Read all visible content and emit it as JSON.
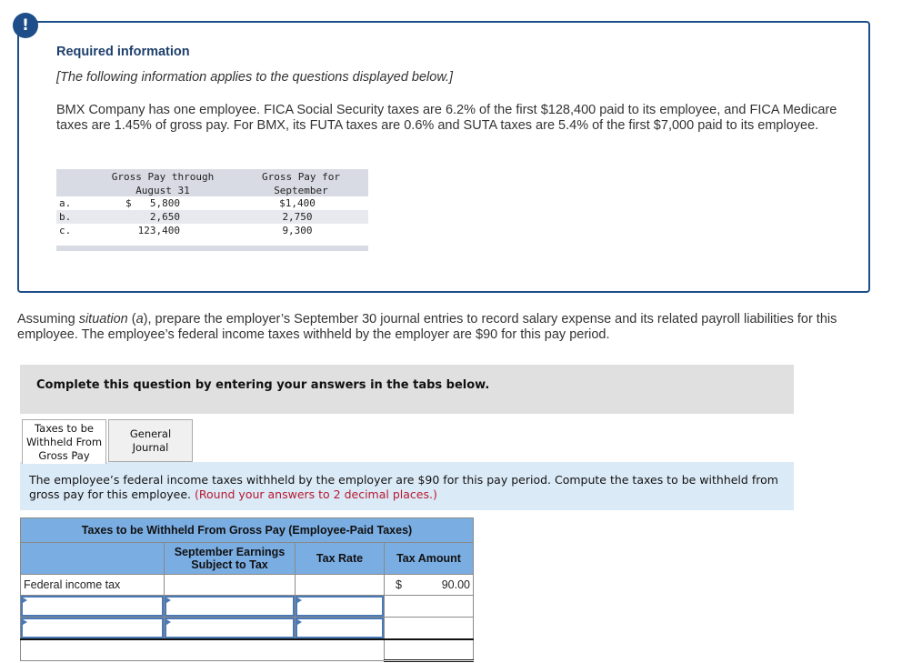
{
  "info": {
    "icon": "!",
    "title": "Required information",
    "italic_note": "[The following information applies to the questions displayed below.]",
    "body": "BMX Company has one employee. FICA Social Security taxes are 6.2% of the first $128,400 paid to its employee, and FICA Medicare taxes are 1.45% of gross pay. For BMX, its FUTA taxes are 0.6% and SUTA taxes are 5.4% of the first $7,000 paid to its employee."
  },
  "gross_pay_table": {
    "headers": [
      "Gross Pay through August 31",
      "Gross Pay for September"
    ],
    "header_lines": [
      [
        "Gross Pay through",
        "August 31"
      ],
      [
        "Gross Pay for",
        "September"
      ]
    ],
    "rows": [
      {
        "label": "a.",
        "currency": "$",
        "through_aug": "5,800",
        "september": "$1,400"
      },
      {
        "label": "b.",
        "currency": "",
        "through_aug": "2,650",
        "september": "2,750"
      },
      {
        "label": "c.",
        "currency": "",
        "through_aug": "123,400",
        "september": "9,300"
      }
    ]
  },
  "question": {
    "prefix": "Assuming ",
    "italic1": "situation",
    "mid": " (",
    "italic2": "a",
    "suffix": "), prepare the employer’s September 30 journal entries to record salary expense and its related payroll liabilities for this employee. The employee’s federal income taxes withheld by the employer are $90 for this pay period."
  },
  "instructions": "Complete this question by entering your answers in the tabs below.",
  "tabs": [
    {
      "label": "Taxes to be Withheld From Gross Pay",
      "active": true
    },
    {
      "label": "General Journal",
      "active": false
    }
  ],
  "prompt": {
    "text": "The employee’s federal income taxes withheld by the employer are $90 for this pay period. Compute the taxes to be withheld from gross pay for this employee.",
    "note": "(Round your answers to 2 decimal places.)"
  },
  "tax_table": {
    "title": "Taxes to be Withheld From Gross Pay (Employee-Paid Taxes)",
    "columns": [
      "",
      "September Earnings Subject to Tax",
      "Tax Rate",
      "Tax Amount"
    ],
    "rows": [
      {
        "label": "Federal income tax",
        "earnings": "",
        "rate": "",
        "currency": "$",
        "amount": "90.00",
        "editable": false
      },
      {
        "label": "",
        "earnings": "",
        "rate": "",
        "amount": "",
        "editable": true
      },
      {
        "label": "",
        "earnings": "",
        "rate": "",
        "amount": "",
        "editable": true
      }
    ],
    "total": {
      "label": "",
      "amount": ""
    }
  },
  "colors": {
    "info_border": "#1d4e89",
    "table_header": "#7aade2",
    "prompt_bg": "#dbeaf7",
    "instr_bg": "#e0e0e0",
    "note_red": "#b8192f"
  }
}
